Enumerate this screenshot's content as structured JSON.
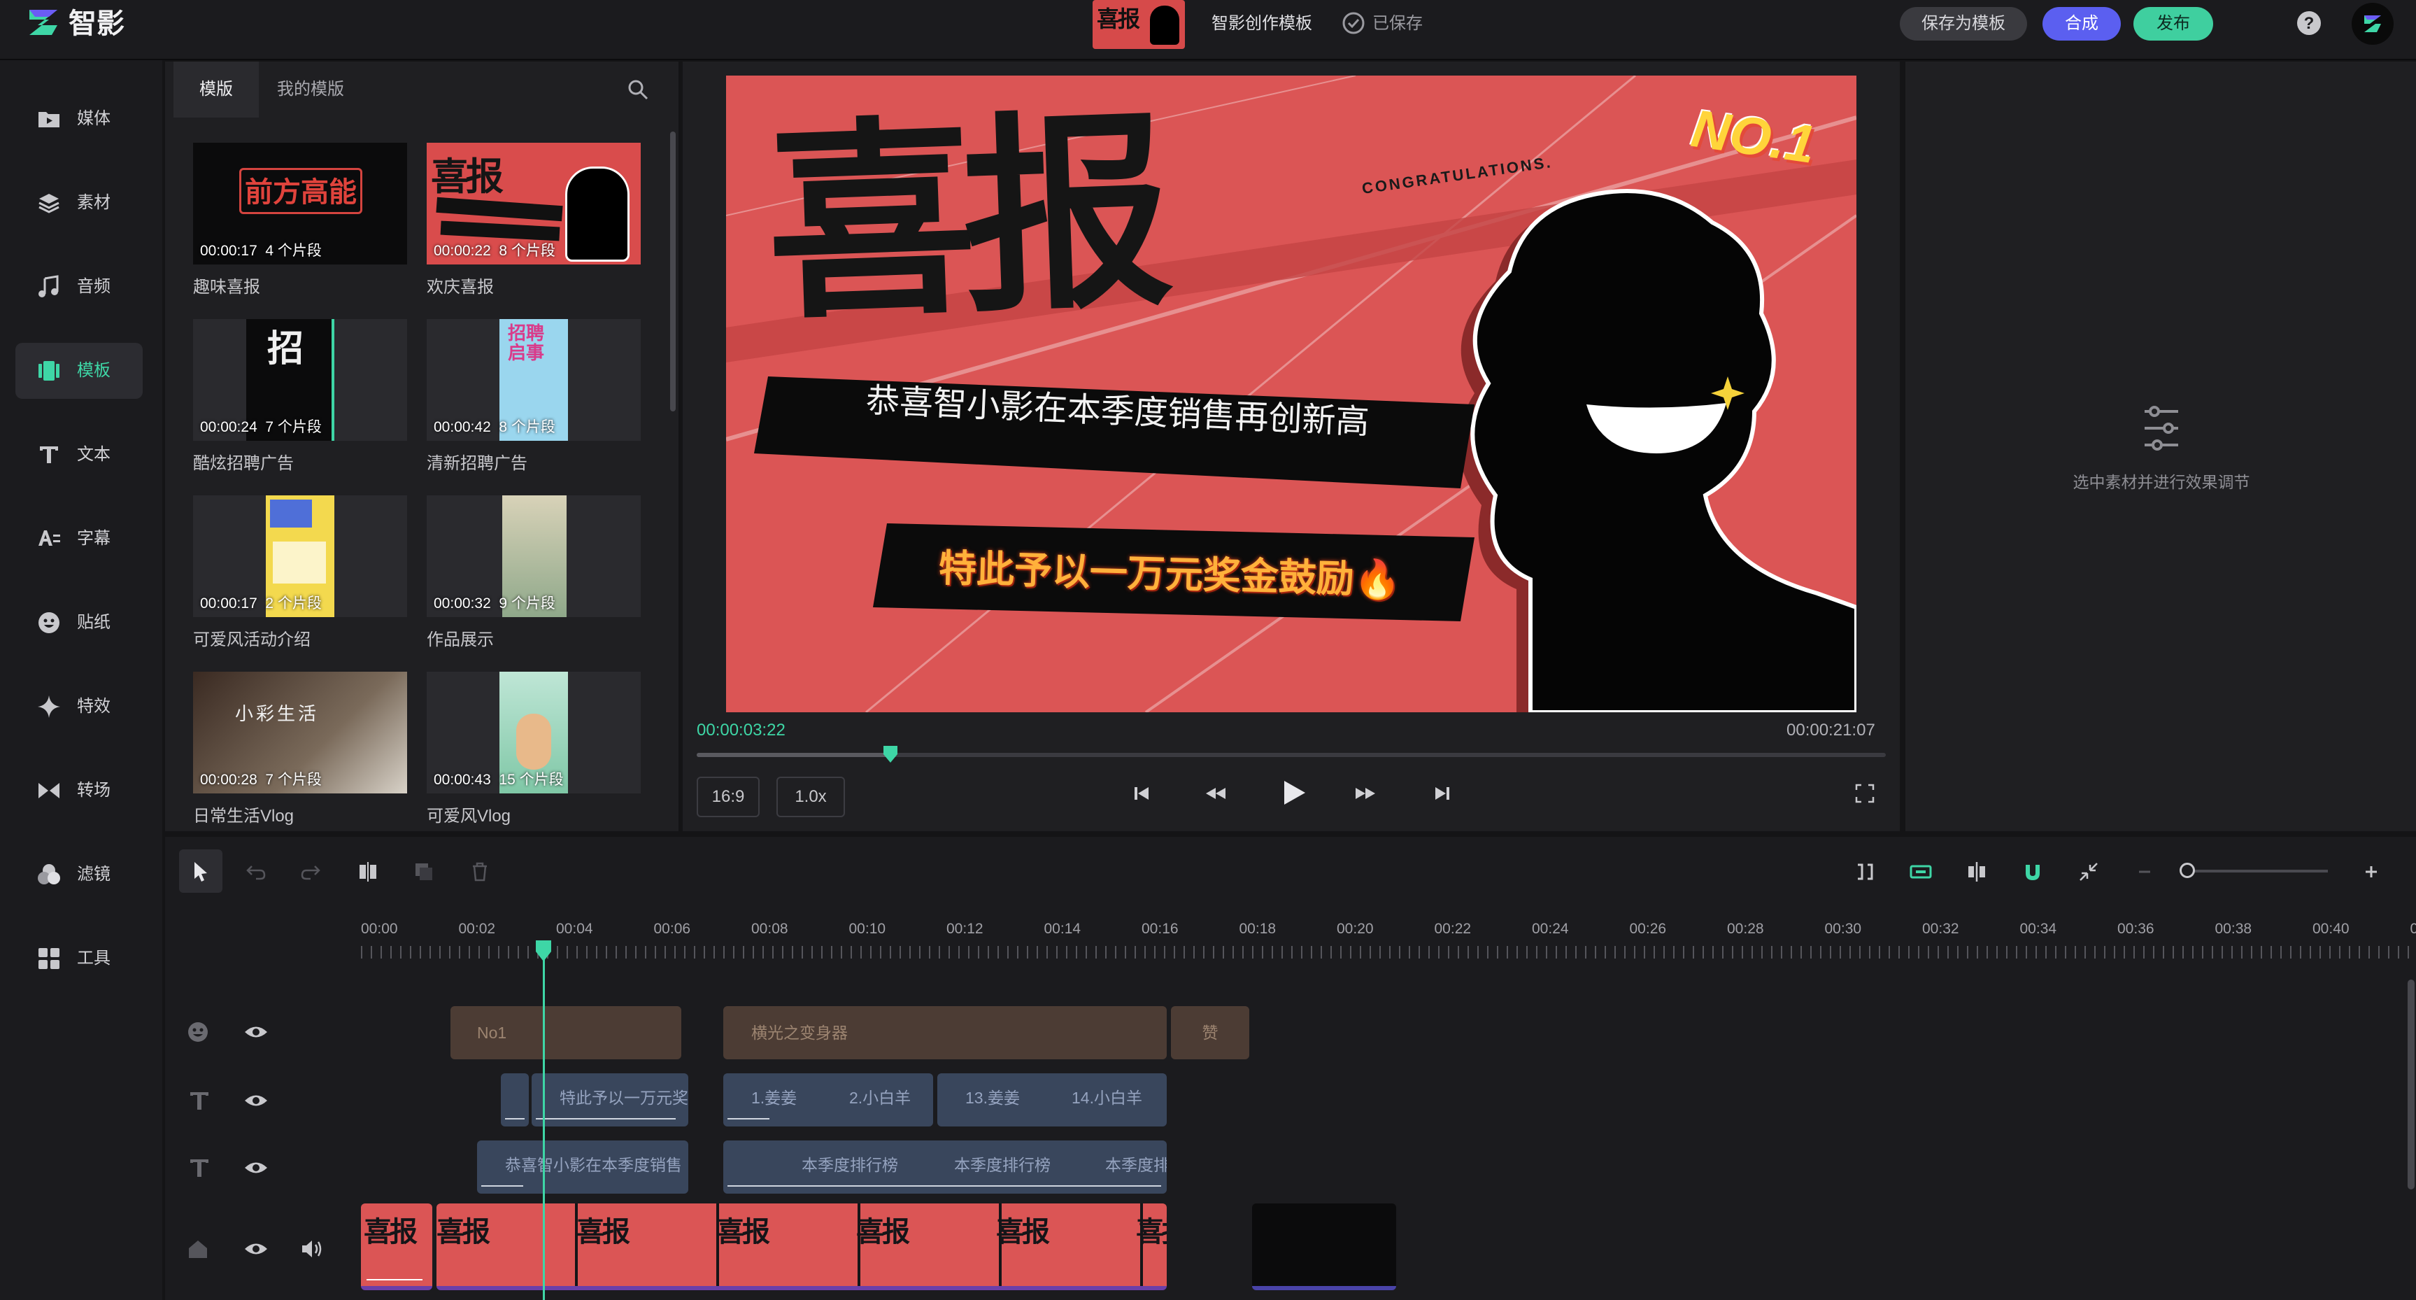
{
  "app": {
    "name": "智影"
  },
  "header": {
    "project_name": "智影创作模板",
    "save_status": "已保存",
    "save_template_label": "保存为模板",
    "export_label": "合成",
    "publish_label": "发布"
  },
  "nav": {
    "items": [
      {
        "label": "媒体",
        "icon": "media-icon"
      },
      {
        "label": "素材",
        "icon": "layers-icon"
      },
      {
        "label": "音频",
        "icon": "music-icon"
      },
      {
        "label": "模板",
        "icon": "template-icon",
        "active": true
      },
      {
        "label": "文本",
        "icon": "text-icon"
      },
      {
        "label": "字幕",
        "icon": "subtitle-icon"
      },
      {
        "label": "贴纸",
        "icon": "sticker-icon"
      },
      {
        "label": "特效",
        "icon": "effects-icon"
      },
      {
        "label": "转场",
        "icon": "transition-icon"
      },
      {
        "label": "滤镜",
        "icon": "filter-icon"
      },
      {
        "label": "工具",
        "icon": "tools-icon"
      }
    ]
  },
  "template_panel": {
    "tabs": [
      "模版",
      "我的模版"
    ],
    "cards": [
      {
        "title": "趣味喜报",
        "duration": "00:00:17",
        "segments": "4 个片段",
        "thumb_text": "前方高能"
      },
      {
        "title": "欢庆喜报",
        "duration": "00:00:22",
        "segments": "8 个片段",
        "thumb_text": "喜报"
      },
      {
        "title": "酷炫招聘广告",
        "duration": "00:00:24",
        "segments": "7 个片段",
        "thumb_text": "招"
      },
      {
        "title": "清新招聘广告",
        "duration": "00:00:42",
        "segments": "8 个片段",
        "thumb_text": "招聘启事"
      },
      {
        "title": "可爱风活动介绍",
        "duration": "00:00:17",
        "segments": "2 个片段",
        "thumb_text": ""
      },
      {
        "title": "作品展示",
        "duration": "00:00:32",
        "segments": "9 个片段",
        "thumb_text": ""
      },
      {
        "title": "日常生活Vlog",
        "duration": "00:00:28",
        "segments": "7 个片段",
        "thumb_text": "小彩生活"
      },
      {
        "title": "可爱风Vlog",
        "duration": "00:00:43",
        "segments": "15 个片段",
        "thumb_text": ""
      }
    ]
  },
  "preview": {
    "canvas": {
      "headline": "喜报",
      "banner_line1": "恭喜智小影在本季度销售再创新高",
      "banner_line2": "特此予以一万元奖金鼓励🔥",
      "badge": "NO.1",
      "ribbon_text": "CONGRATULATIONS."
    },
    "current_time": "00:00:03:22",
    "total_time": "00:00:21:07",
    "progress": 0.163,
    "aspect_ratio": "16:9",
    "speed": "1.0x"
  },
  "inspector": {
    "hint": "选中素材并进行效果调节"
  },
  "timeline": {
    "ruler": [
      "00:00",
      "00:02",
      "00:04",
      "00:06",
      "00:08",
      "00:10",
      "00:12",
      "00:14",
      "00:16",
      "00:18",
      "00:20",
      "00:22",
      "00:24",
      "00:26",
      "00:28",
      "00:30",
      "00:32",
      "00:34",
      "00:36",
      "00:38",
      "00:40",
      "00"
    ],
    "playhead": "00:04",
    "tracks": {
      "sticker": [
        "No1",
        "横光之变身器",
        "赞"
      ],
      "text1": [
        "特此予以一万元奖",
        "1.姜姜",
        "2.小白羊",
        "13.姜姜",
        "14.小白羊"
      ],
      "text2": [
        "恭喜智小影在本季度销售",
        "本季度排行榜",
        "本季度排行榜",
        "本季度排"
      ],
      "video_frame_text": "喜报"
    }
  },
  "colors": {
    "accent": "#3ed6a6",
    "export": "#5b5ff0",
    "publish": "#3fcf9f",
    "canvas_red": "#db5555"
  }
}
